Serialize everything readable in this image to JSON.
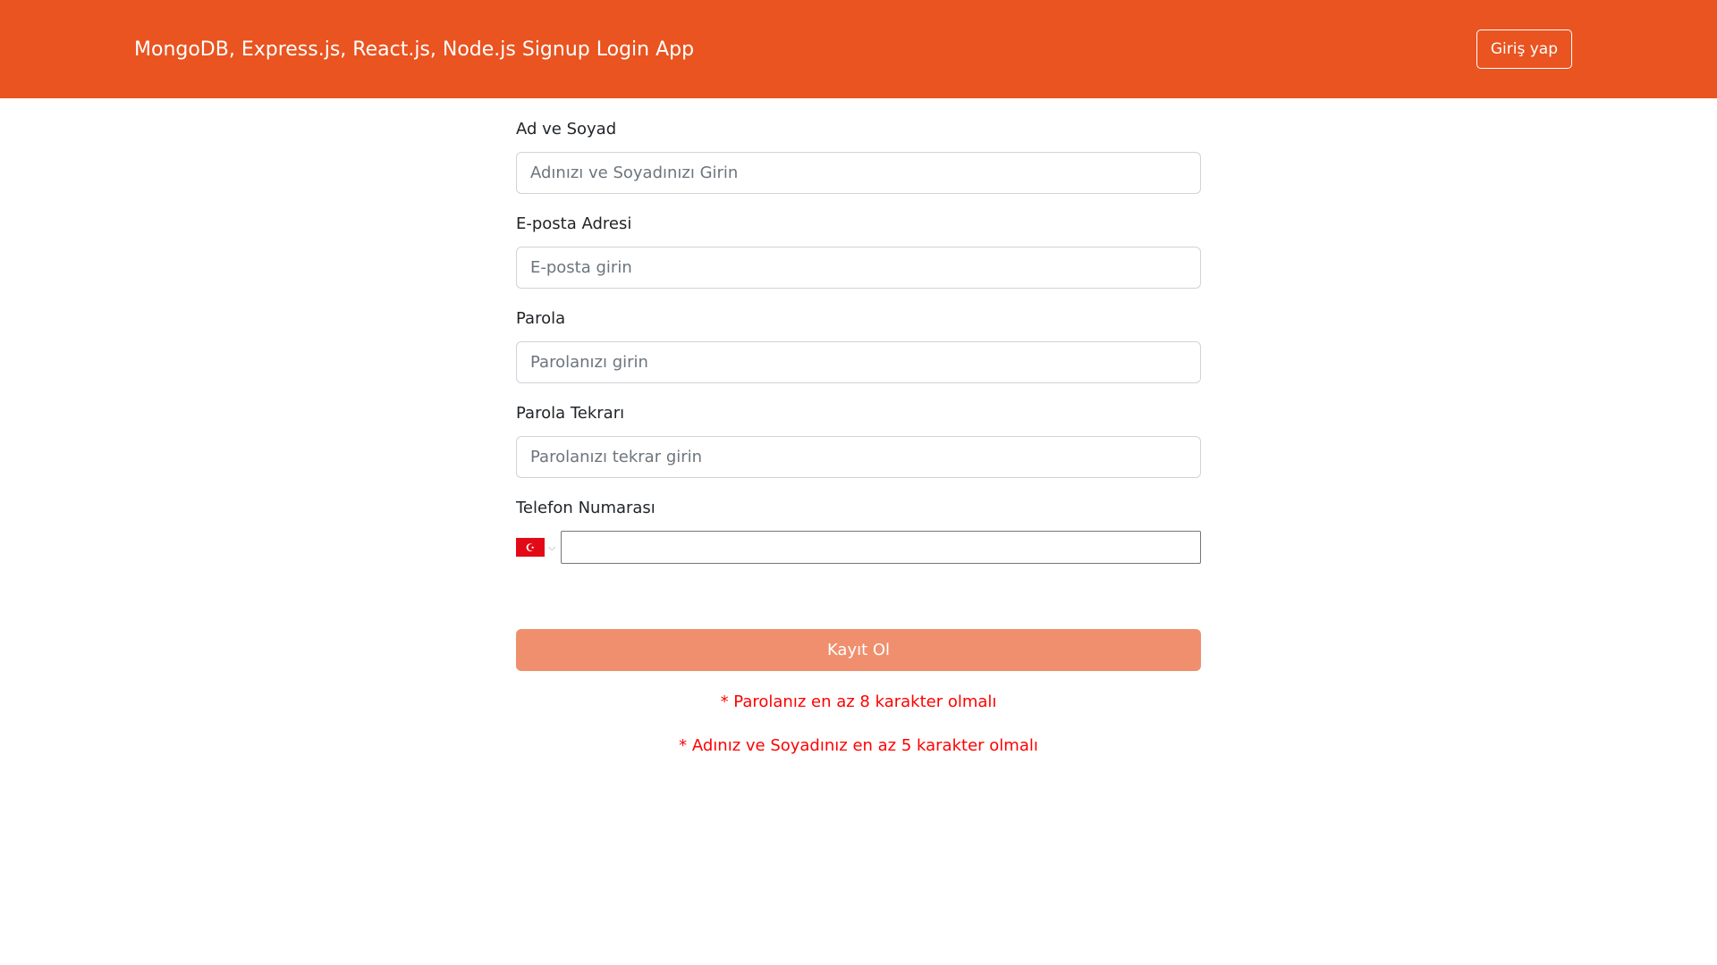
{
  "header": {
    "title": "MongoDB, Express.js, React.js, Node.js Signup Login App",
    "login_label": "Giriş yap"
  },
  "form": {
    "name_label": "Ad ve Soyad",
    "name_placeholder": "Adınızı ve Soyadınızı Girin",
    "email_label": "E-posta Adresi",
    "email_placeholder": "E-posta girin",
    "password_label": "Parola",
    "password_placeholder": "Parolanızı girin",
    "password_repeat_label": "Parola Tekrarı",
    "password_repeat_placeholder": "Parolanızı tekrar girin",
    "phone_label": "Telefon Numarası",
    "phone_country": "turkey-flag-icon",
    "phone_value": "",
    "submit_label": "Kayıt Ol"
  },
  "errors": [
    "* Parolanız en az 8 karakter olmalı",
    "* Adınız ve Soyadınız en az 5 karakter olmalı"
  ],
  "colors": {
    "navbar": "#e95420",
    "submit_disabled": "#f08f6e",
    "error": "#ff0000"
  }
}
